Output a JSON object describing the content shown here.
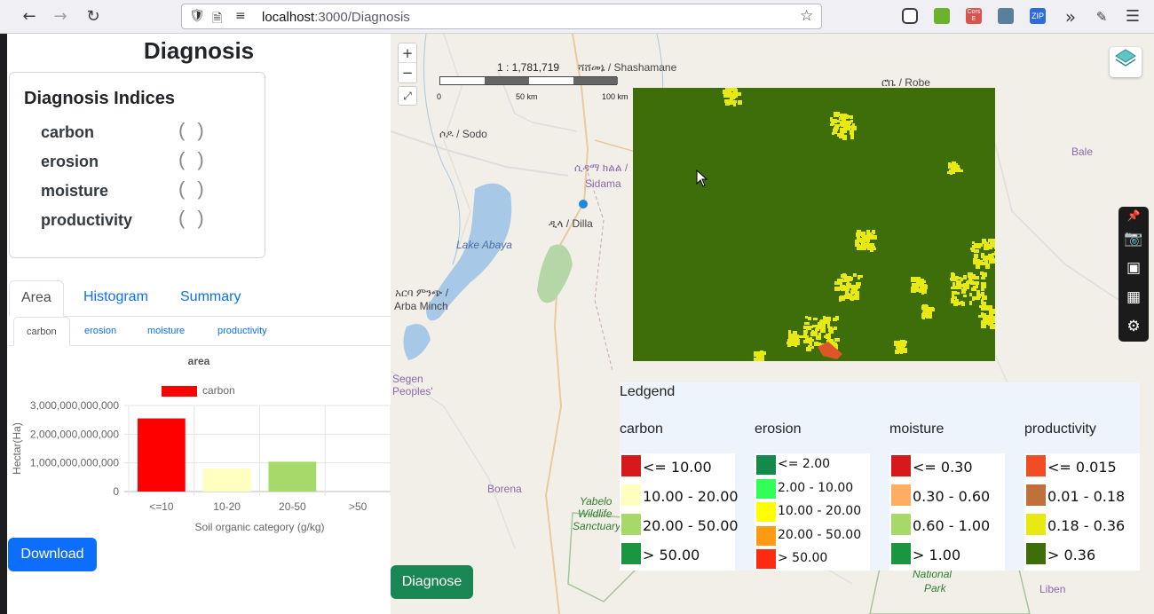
{
  "browser": {
    "url_host": "localhost",
    "url_path": ":3000/Diagnosis",
    "back_icon": "arrow-left-icon",
    "forward_icon": "arrow-right-icon",
    "reload_icon": "reload-icon",
    "extensions": [
      {
        "name": "pocket-icon",
        "label": "",
        "color": "#ffffff"
      },
      {
        "name": "download-ext-icon",
        "label": "",
        "color": "#6bb32b"
      },
      {
        "name": "cors-ext-icon",
        "label": "Cors E",
        "color": "#d9534f"
      },
      {
        "name": "pencil-ext-icon",
        "label": "",
        "color": "#5a7f9a"
      },
      {
        "name": "zip-ext-icon",
        "label": "ZIP",
        "color": "#2f6bd9"
      }
    ]
  },
  "page": {
    "title": "Diagnosis",
    "indices_title": "Diagnosis Indices",
    "indices": [
      "carbon",
      "erosion",
      "moisture",
      "productivity"
    ],
    "tabs": [
      "Area",
      "Histogram",
      "Summary"
    ],
    "active_tab": "Area",
    "subtabs": [
      "carbon",
      "erosion",
      "moisture",
      "productivity"
    ],
    "active_subtab": "carbon",
    "download_label": "Download",
    "diagnose_label": "Diagnose"
  },
  "chart_data": {
    "type": "bar",
    "title": "area",
    "categories": [
      "<=10",
      "10-20",
      "20-50",
      ">50"
    ],
    "series": [
      {
        "name": "carbon",
        "values": [
          2550000000000,
          810000000000,
          1040000000000,
          0
        ]
      }
    ],
    "bar_colors": [
      "#ff0000",
      "#ffffc0",
      "#a6d96a",
      "#1a9641"
    ],
    "legend_color": "#ff0000",
    "xlabel": "Soil organic category (g/kg)",
    "ylabel": "Hectar(Ha)",
    "ylim": [
      0,
      3000000000000
    ],
    "yticks": [
      "0",
      "1,000,000,000,000",
      "2,000,000,000,000",
      "3,000,000,000,000"
    ],
    "yticks_values": [
      0,
      1000000000000,
      2000000000000,
      3000000000000
    ],
    "grid": true,
    "legend_position": "top"
  },
  "map": {
    "scale_ratio": "1 : 1,781,719",
    "scale_labels": [
      "0",
      "50 km",
      "100 km"
    ],
    "places": [
      {
        "text": "ሻሸመኔ / Shashamane",
        "style": ""
      },
      {
        "text": "ሮቤ / Robe",
        "style": ""
      },
      {
        "text": "ሶዶ / Sodo",
        "style": ""
      },
      {
        "text": "ሲዳማ ክልል /",
        "style": "purple"
      },
      {
        "text": "Sidama",
        "style": "purple"
      },
      {
        "text": "ዲላ / Dilla",
        "style": ""
      },
      {
        "text": "Bale",
        "style": "purple"
      },
      {
        "text": "Lake Abaya",
        "style": "blue"
      },
      {
        "text": "አርባ ምንጭ /",
        "style": ""
      },
      {
        "text": "Arba Minch",
        "style": ""
      },
      {
        "text": "Segen",
        "style": "purple"
      },
      {
        "text": "Peoples'",
        "style": "purple"
      },
      {
        "text": "Borena",
        "style": "purple"
      },
      {
        "text": "Yabelo",
        "style": "green"
      },
      {
        "text": "Wildlife",
        "style": "green"
      },
      {
        "text": "Sanctuary",
        "style": "green"
      },
      {
        "text": "National",
        "style": "green"
      },
      {
        "text": "Park",
        "style": "green"
      },
      {
        "text": "Liben",
        "style": "purple"
      }
    ],
    "raster_base_color": "#3d6e0a",
    "raster_patch_color": "#e8e812",
    "raster_red_color": "#e0542a",
    "toolbar_icons": [
      "pin-icon",
      "camera-icon",
      "video-icon",
      "gallery-icon",
      "gear-icon"
    ],
    "zoom_in": "+",
    "zoom_out": "−"
  },
  "legend": {
    "title": "Ledgend",
    "columns": [
      {
        "title": "carbon",
        "items": [
          {
            "label": "<= 10.00",
            "color": "#d7191c"
          },
          {
            "label": "10.00 - 20.00",
            "color": "#ffffc0"
          },
          {
            "label": "20.00 - 50.00",
            "color": "#a6d96a"
          },
          {
            "label": "> 50.00",
            "color": "#1a9641"
          }
        ]
      },
      {
        "title": "erosion",
        "items": [
          {
            "label": "<= 2.00",
            "color": "#138a4a"
          },
          {
            "label": "2.00 - 10.00",
            "color": "#32ff5a"
          },
          {
            "label": "10.00 - 20.00",
            "color": "#ffff00"
          },
          {
            "label": "20.00 - 50.00",
            "color": "#ff9a12"
          },
          {
            "label": "> 50.00",
            "color": "#ff2a12"
          }
        ]
      },
      {
        "title": "moisture",
        "items": [
          {
            "label": "<= 0.30",
            "color": "#d7191c"
          },
          {
            "label": "0.30 - 0.60",
            "color": "#fdae61"
          },
          {
            "label": "0.60 - 1.00",
            "color": "#a6d96a"
          },
          {
            "label": "> 1.00",
            "color": "#1a9641"
          }
        ]
      },
      {
        "title": "productivity",
        "items": [
          {
            "label": "<= 0.015",
            "color": "#f14c23"
          },
          {
            "label": "0.01 - 0.18",
            "color": "#c0703a"
          },
          {
            "label": "0.18 - 0.36",
            "color": "#e8e812"
          },
          {
            "label": "> 0.36",
            "color": "#3d6e0a"
          }
        ]
      }
    ]
  }
}
